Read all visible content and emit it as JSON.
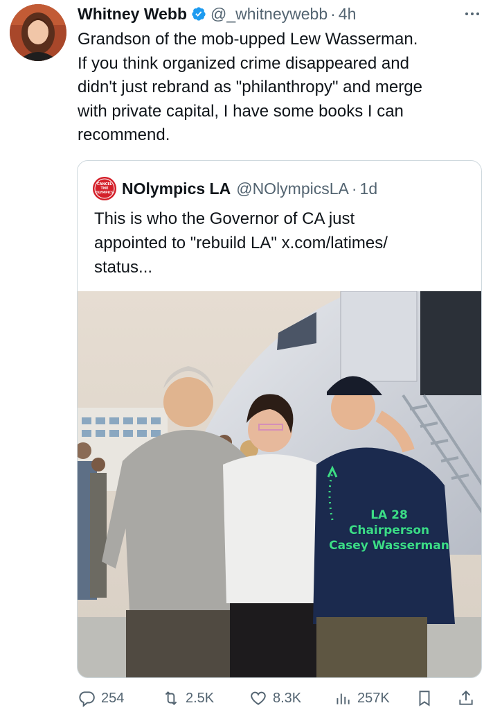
{
  "tweet": {
    "author_name": "Whitney Webb",
    "handle": "@_whitneywebb",
    "separator": "·",
    "time": "4h",
    "text": "Grandson of the mob-upped Lew Wasserman.\nIf you think organized crime disappeared and\ndidn't just rebrand as \"philanthropy\" and merge\nwith private capital, I have some books I can\nrecommend."
  },
  "quote": {
    "author_name": "NOlympics LA",
    "handle": "@NOlympicsLA",
    "separator": "·",
    "time": "1d",
    "avatar_text": "CANCEL THE OLYMPICS",
    "text": "This is who the Governor of CA just\nappointed to \"rebuild LA\" x.com/latimes/\nstatus...",
    "image_caption": "LA 28\nChairperson\nCasey Wasserman"
  },
  "actions": {
    "replies": "254",
    "reposts": "2.5K",
    "likes": "8.3K",
    "views": "257K"
  },
  "colors": {
    "verified": "#1d9bf0",
    "text_secondary": "#536471",
    "border": "#cfd9de",
    "caption": "#3ddc84"
  }
}
